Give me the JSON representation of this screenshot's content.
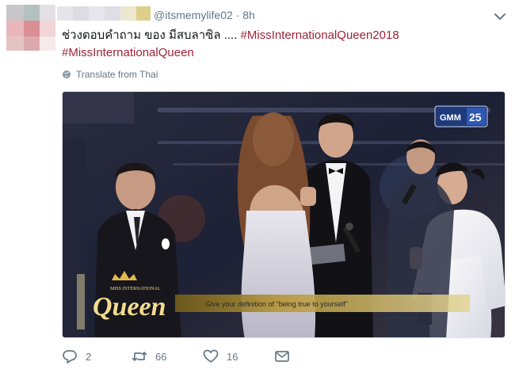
{
  "tweet": {
    "handle": "@itsmemylife02",
    "separator": " · ",
    "time": "8h",
    "text_plain": "ช่วงตอบคำถาม ของ มีสบลาซิล ....",
    "hashtag_1": "#MissInternationalQueen2018",
    "hashtag_2": "#MissInternationalQueen",
    "translate_label": "Translate from Thai"
  },
  "media": {
    "channel_logo": "GMM",
    "channel_number": "25",
    "show_logo_small": "MISS INTERNATIONAL",
    "show_logo_big": "Queen",
    "caption": "Give your definition of \"being true to yourself\""
  },
  "actions": {
    "reply_count": "2",
    "retweet_count": "66",
    "like_count": "16"
  },
  "colors": {
    "hashtag": "#9f2239",
    "secondary_text": "#657786"
  },
  "icons": [
    "chevron-down-icon",
    "globe-icon",
    "reply-icon",
    "retweet-icon",
    "like-icon",
    "message-icon"
  ]
}
